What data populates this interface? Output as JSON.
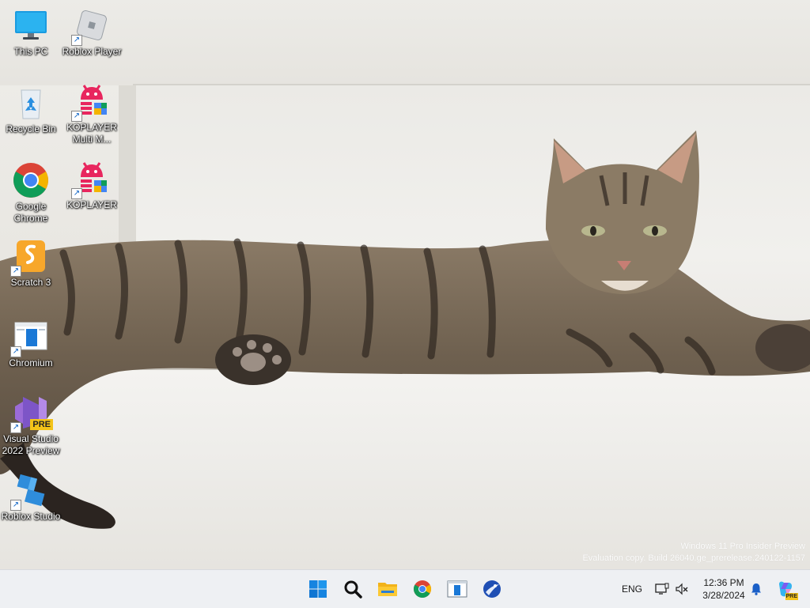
{
  "desktop": {
    "icons": [
      {
        "label": "This PC",
        "icon": "monitor-icon"
      },
      {
        "label": "Roblox Player",
        "icon": "roblox-player-icon"
      },
      {
        "label": "Recycle Bin",
        "icon": "recycle-bin-icon"
      },
      {
        "label": "KOPLAYER Multi M...",
        "icon": "koplayer-icon"
      },
      {
        "label": "Google Chrome",
        "icon": "chrome-icon"
      },
      {
        "label": "KOPLAYER",
        "icon": "koplayer-icon"
      },
      {
        "label": "Scratch 3",
        "icon": "scratch-icon"
      },
      {
        "label": "Chromium",
        "icon": "chromium-icon"
      },
      {
        "label": "Visual Studio 2022 Preview",
        "icon": "visual-studio-icon",
        "badge": "PRE"
      },
      {
        "label": "Roblox Studio",
        "icon": "roblox-studio-icon"
      }
    ],
    "watermark": {
      "line1": "Windows 11 Pro Insider Preview",
      "line2": "Evaluation copy. Build 26040.ge_prerelease.240122-1157"
    }
  },
  "taskbar": {
    "apps": [
      {
        "name": "Start",
        "icon": "windows-start-icon"
      },
      {
        "name": "Search",
        "icon": "search-icon"
      },
      {
        "name": "File Explorer",
        "icon": "folder-icon"
      },
      {
        "name": "Google Chrome",
        "icon": "chrome-icon"
      },
      {
        "name": "Chromium",
        "icon": "chromium-icon"
      },
      {
        "name": "Seamonkey",
        "icon": "browser-globe-icon"
      }
    ],
    "tray": {
      "language": "ENG",
      "time": "12:36 PM",
      "date": "3/28/2024",
      "copilot_badge": "PRE"
    }
  },
  "colors": {
    "accent": "#0067c0",
    "chrome_red": "#db4437",
    "chrome_green": "#0f9d58",
    "chrome_yellow": "#f4b400",
    "chrome_blue": "#4285f4",
    "koplayer_pink": "#e8265e",
    "roblox_blue": "#2f8ddb",
    "scratch_orange": "#f7a72b",
    "vs_purple": "#9b6bd7"
  }
}
